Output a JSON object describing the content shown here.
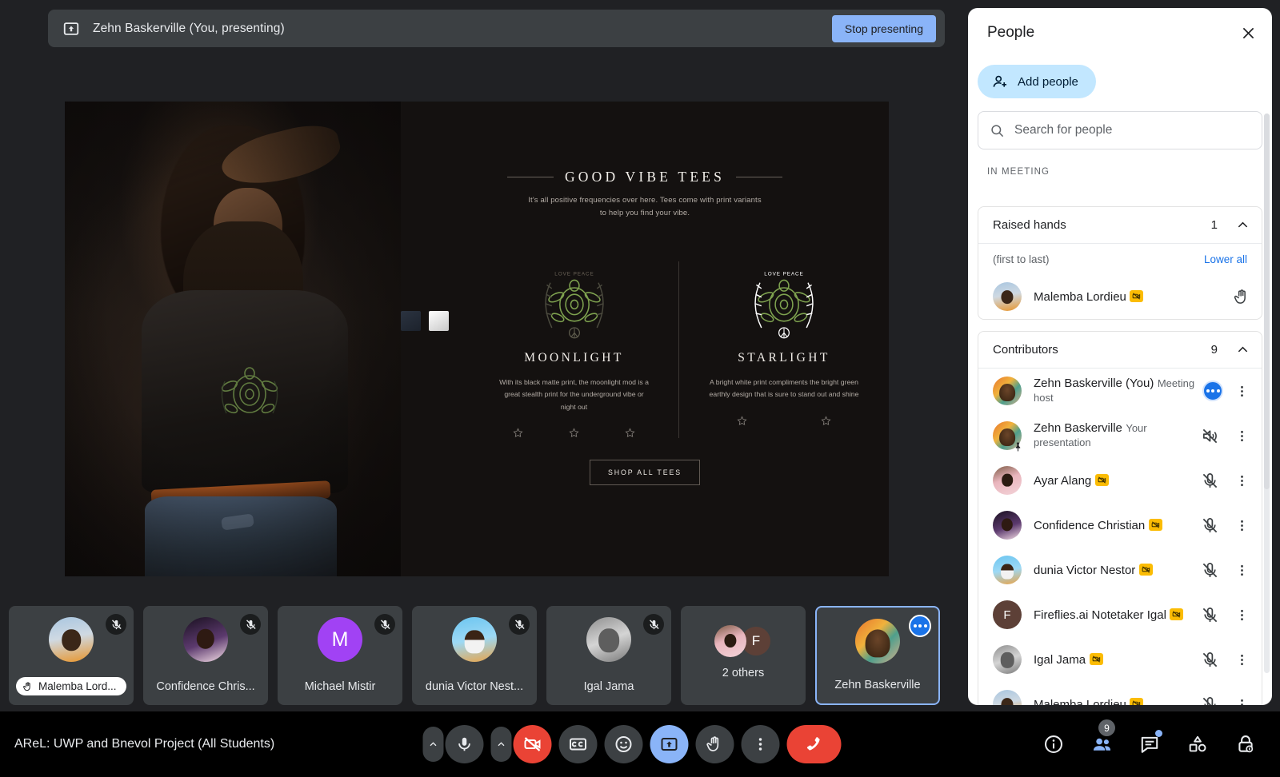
{
  "presentation_banner": {
    "icon": "present-screen-icon",
    "title": "Zehn Baskerville (You, presenting)",
    "stop_label": "Stop presenting"
  },
  "slide": {
    "brand_title": "GOOD VIBE TEES",
    "brand_subtitle": "It's all positive frequencies over here. Tees come with print variants to help you find your vibe.",
    "swatches": [
      {
        "name": "navy-swatch",
        "color": "#2b3340"
      },
      {
        "name": "white-swatch",
        "color": "#ffffff"
      }
    ],
    "products": [
      {
        "name": "MOONLIGHT",
        "description": "With its black matte print, the moonlight mod is a great stealth print for the underground vibe or night out",
        "graphic_text": "LOVE PEACE",
        "stars": 3
      },
      {
        "name": "STARLIGHT",
        "description": "A bright white print compliments the bright green earthly design that is sure to stand out and shine",
        "graphic_text": "LOVE PEACE",
        "stars": 2
      }
    ],
    "shop_button": "SHOP ALL TEES"
  },
  "filmstrip": [
    {
      "name": "Malemba Lord...",
      "avatar": "av-malemba",
      "initial": "",
      "muted": true,
      "hand_raised": true,
      "self": false
    },
    {
      "name": "Confidence Chris...",
      "avatar": "av-conf",
      "initial": "",
      "muted": true,
      "hand_raised": false,
      "self": false
    },
    {
      "name": "Michael Mistir",
      "avatar": "av-michael",
      "initial": "M",
      "muted": true,
      "hand_raised": false,
      "self": false
    },
    {
      "name": "dunia Victor Nest...",
      "avatar": "av-dunia",
      "initial": "",
      "muted": true,
      "hand_raised": false,
      "self": false
    },
    {
      "name": "Igal Jama",
      "avatar": "av-igal",
      "initial": "",
      "muted": true,
      "hand_raised": false,
      "self": false
    },
    {
      "name": "2 others",
      "avatar": "",
      "initial": "",
      "muted": false,
      "hand_raised": false,
      "self": false,
      "is_overflow": true,
      "overflow_avatars": [
        {
          "avatar": "av-ayar",
          "initial": ""
        },
        {
          "avatar": "av-fire",
          "initial": "F"
        }
      ]
    },
    {
      "name": "Zehn Baskerville",
      "avatar": "av-zehn",
      "initial": "",
      "muted": false,
      "hand_raised": false,
      "self": true,
      "speaking": true
    }
  ],
  "bottom_bar": {
    "meeting_title": "AReL: UWP and Bnevol Project (All Students)",
    "controls": [
      {
        "name": "mic-options-chevron",
        "icon": "chevron-up-icon",
        "style": "chev"
      },
      {
        "name": "microphone-button",
        "icon": "microphone-icon",
        "style": "dark"
      },
      {
        "name": "camera-options-chevron",
        "icon": "chevron-up-icon",
        "style": "chev"
      },
      {
        "name": "camera-button",
        "icon": "camera-off-icon",
        "style": "red"
      },
      {
        "name": "captions-button",
        "icon": "closed-captions-icon",
        "style": "dark"
      },
      {
        "name": "reactions-button",
        "icon": "emoji-smiley-icon",
        "style": "dark"
      },
      {
        "name": "present-now-button",
        "icon": "present-screen-icon",
        "style": "blue"
      },
      {
        "name": "raise-hand-button",
        "icon": "raised-hand-icon",
        "style": "dark"
      },
      {
        "name": "more-options-button",
        "icon": "more-vertical-icon",
        "style": "dark"
      },
      {
        "name": "leave-call-button",
        "icon": "end-call-icon",
        "style": "end"
      }
    ],
    "right_controls": [
      {
        "name": "meeting-details-button",
        "icon": "info-circle-icon",
        "badge": "",
        "dot": false
      },
      {
        "name": "people-button",
        "icon": "people-icon",
        "badge": "9",
        "dot": false,
        "active": true
      },
      {
        "name": "chat-button",
        "icon": "chat-bubble-icon",
        "badge": "",
        "dot": true
      },
      {
        "name": "activities-button",
        "icon": "shapes-activities-icon",
        "badge": "",
        "dot": false
      },
      {
        "name": "host-controls-button",
        "icon": "lock-shield-icon",
        "badge": "",
        "dot": false
      }
    ]
  },
  "people_panel": {
    "title": "People",
    "close_icon": "close-icon",
    "add_people_label": "Add people",
    "add_people_icon": "person-add-icon",
    "search_placeholder": "Search for people",
    "search_value": "",
    "search_icon": "search-icon",
    "section_label": "IN MEETING",
    "raised_hands": {
      "header": "Raised hands",
      "count": "1",
      "order_note": "(first to last)",
      "lower_all_label": "Lower all",
      "people": [
        {
          "name": "Malemba Lordieu",
          "subtitle": "",
          "avatar": "av-malemba",
          "initial": "",
          "no_camera": true,
          "action_icon": "raised-hand-icon"
        }
      ]
    },
    "contributors": {
      "header": "Contributors",
      "count": "9",
      "people": [
        {
          "name": "Zehn Baskerville (You)",
          "subtitle": "Meeting host",
          "avatar": "av-zehn",
          "initial": "",
          "no_camera": false,
          "pinned": false,
          "status": "speaking",
          "action_icon": "speaking-dots-icon",
          "menu_icon": "more-vertical-icon"
        },
        {
          "name": "Zehn Baskerville",
          "subtitle": "Your presentation",
          "avatar": "av-zehn",
          "initial": "",
          "no_camera": false,
          "pinned": true,
          "status": "muted-presentation",
          "action_icon": "speaker-off-icon",
          "menu_icon": "more-vertical-icon"
        },
        {
          "name": "Ayar Alang",
          "subtitle": "",
          "avatar": "av-ayar",
          "initial": "",
          "no_camera": true,
          "pinned": false,
          "status": "muted",
          "action_icon": "mic-off-icon",
          "menu_icon": "more-vertical-icon"
        },
        {
          "name": "Confidence Christian",
          "subtitle": "",
          "avatar": "av-conf",
          "initial": "",
          "no_camera": true,
          "pinned": false,
          "status": "muted",
          "action_icon": "mic-off-icon",
          "menu_icon": "more-vertical-icon"
        },
        {
          "name": "dunia Victor Nestor",
          "subtitle": "",
          "avatar": "av-dunia",
          "initial": "",
          "no_camera": true,
          "pinned": false,
          "status": "muted",
          "action_icon": "mic-off-icon",
          "menu_icon": "more-vertical-icon"
        },
        {
          "name": "Fireflies.ai Notetaker Igal",
          "subtitle": "",
          "avatar": "av-fire",
          "initial": "F",
          "no_camera": true,
          "pinned": false,
          "status": "muted",
          "action_icon": "mic-off-icon",
          "menu_icon": "more-vertical-icon"
        },
        {
          "name": "Igal Jama",
          "subtitle": "",
          "avatar": "av-igal",
          "initial": "",
          "no_camera": true,
          "pinned": false,
          "status": "muted",
          "action_icon": "mic-off-icon",
          "menu_icon": "more-vertical-icon"
        },
        {
          "name": "Malemba Lordieu",
          "subtitle": "",
          "avatar": "av-malemba",
          "initial": "",
          "no_camera": true,
          "pinned": false,
          "status": "muted",
          "action_icon": "mic-off-icon",
          "menu_icon": "more-vertical-icon"
        }
      ]
    }
  },
  "colors": {
    "accent_blue": "#8ab4f8",
    "link_blue": "#1a73e8",
    "chip_blue": "#c2e7ff",
    "danger_red": "#ea4335",
    "no_camera_yellow": "#fbbc04",
    "panel_white": "#ffffff",
    "stage_dark": "#202124",
    "tile_dark": "#3c4043"
  }
}
